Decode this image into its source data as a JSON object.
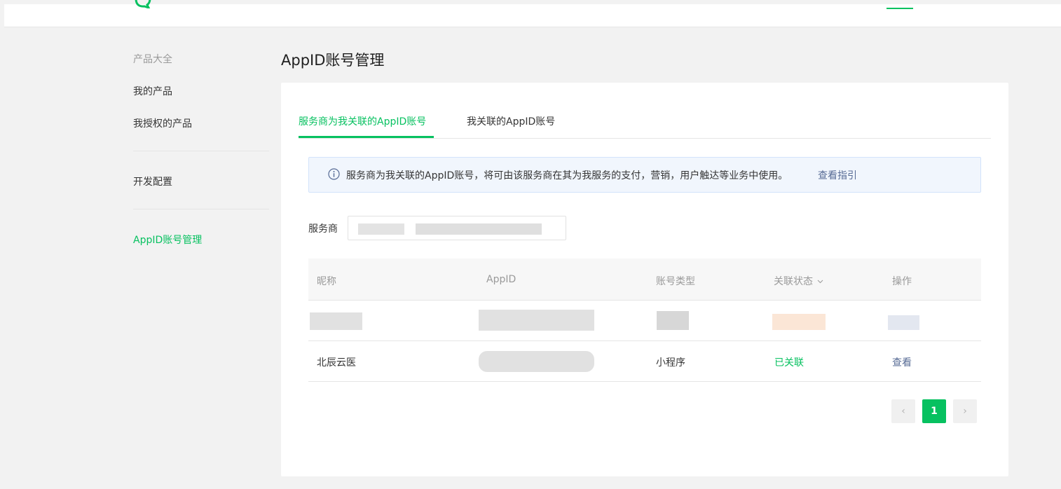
{
  "colors": {
    "brand": "#07c160",
    "link": "#576b95",
    "muted": "#9a9a9a",
    "notice_bg": "#f1f6fd"
  },
  "sidebar": {
    "items": [
      {
        "label": "产品大全",
        "active": false
      },
      {
        "label": "我的产品",
        "active": false
      },
      {
        "label": "我授权的产品",
        "active": false
      },
      {
        "label": "开发配置",
        "active": false
      },
      {
        "label": "AppID账号管理",
        "active": true
      }
    ]
  },
  "page": {
    "title": "AppID账号管理"
  },
  "tabs": [
    {
      "label": "服务商为我关联的AppID账号",
      "active": true
    },
    {
      "label": "我关联的AppID账号",
      "active": false
    }
  ],
  "notice": {
    "icon": "info-icon",
    "text": "服务商为我关联的AppID账号，将可由该服务商在其为我服务的支付，营销，用户触达等业务中使用。",
    "link": "查看指引"
  },
  "filter": {
    "label": "服务商",
    "value": ""
  },
  "table": {
    "headers": [
      "昵称",
      "AppID",
      "账号类型",
      "关联状态",
      "操作"
    ],
    "sort_icon": "chevron-down-icon",
    "rows": [
      {
        "nickname": "",
        "appid": "",
        "type": "",
        "status": "",
        "action": ""
      },
      {
        "nickname": "北辰云医",
        "appid": "",
        "type": "小程序",
        "status": "已关联",
        "action": "查看"
      }
    ]
  },
  "pagination": {
    "prev": "‹",
    "current": "1",
    "next": "›"
  }
}
